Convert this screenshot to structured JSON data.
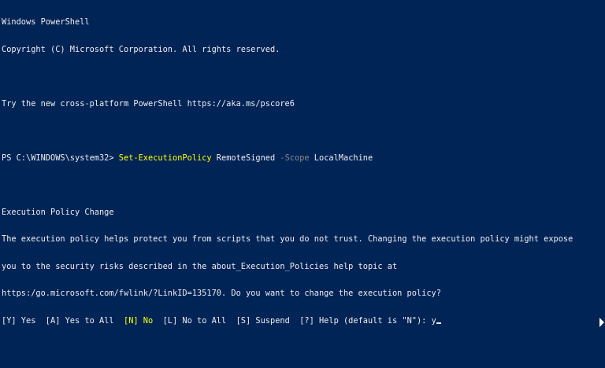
{
  "window": {
    "title_line": "Windows PowerShell",
    "copyright": "Copyright (C) Microsoft Corporation. All rights reserved.",
    "tip": "Try the new cross-platform PowerShell https://aka.ms/pscore6"
  },
  "command": {
    "prompt": "PS C:\\WINDOWS\\system32> ",
    "cmdlet": "Set-ExecutionPolicy",
    "arg1": " RemoteSigned ",
    "param": "-Scope",
    "arg2": " LocalMachine"
  },
  "policy_change": {
    "heading": "Execution Policy Change",
    "lines": [
      "The execution policy helps protect you from scripts that you do not trust. Changing the execution policy might expose",
      "you to the security risks described in the about_Execution_Policies help topic at",
      "https:/go.microsoft.com/fwlink/?LinkID=135170. Do you want to change the execution policy?"
    ],
    "choices": {
      "yes": "[Y] Yes  ",
      "yes_all": "[A] Yes to All  ",
      "no": "[N] No",
      "no_all": "  [L] No to All  ",
      "suspend": "[S] Suspend  ",
      "help": "[?] Help (default is \"N\"): ",
      "input": "y"
    }
  },
  "colors": {
    "background": "#012456",
    "foreground": "#eeedf0",
    "cmdlet": "#ffff00",
    "parameter": "#8a8a8a",
    "default_choice": "#ffff00"
  }
}
